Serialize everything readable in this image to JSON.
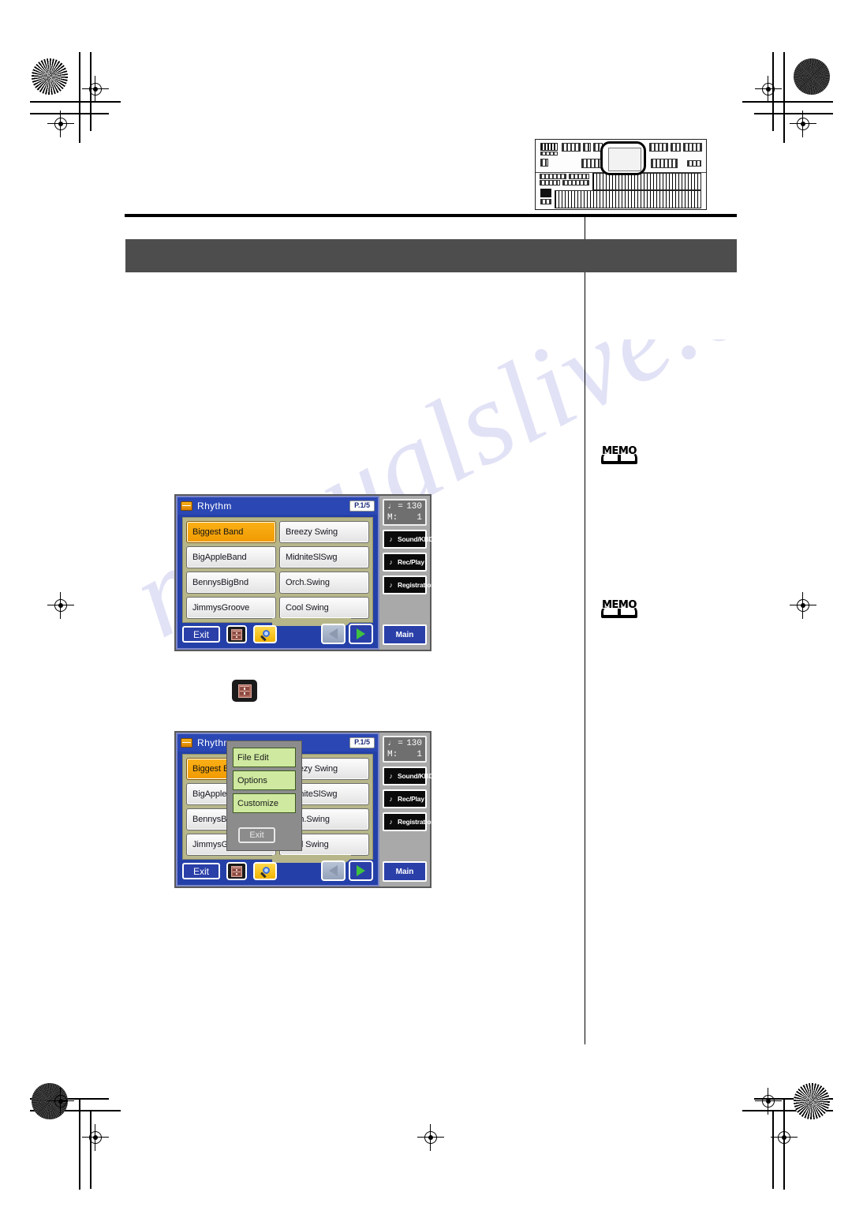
{
  "page": {
    "background_color": "#ffffff",
    "band_color": "#4d4d4d",
    "watermark_text": "manualslive.com"
  },
  "illustration": {
    "name": "electronic-organ-front-panel",
    "highlight": "lcd-touch-screen"
  },
  "memos": [
    {
      "label": "MEMO"
    },
    {
      "label": "MEMO"
    }
  ],
  "callout": {
    "icon_label": "menu-icon"
  },
  "screen1": {
    "title": "Rhythm",
    "page_indicator": "P.1/5",
    "rhythms": [
      "Biggest Band",
      "Breezy Swing",
      "BigAppleBand",
      "MidniteSlSwg",
      "BennysBigBnd",
      "Orch.Swing",
      "JimmysGroove",
      "Cool Swing"
    ],
    "selected_index": 0,
    "toolbar": {
      "exit_label": "Exit",
      "menu_icon": "menu-icon",
      "search_icon": "search-icon",
      "prev_icon": "triangle-left-icon",
      "next_icon": "triangle-right-icon"
    },
    "rail": {
      "tempo_note": "♩ =",
      "tempo_value": "130",
      "measure_label": "M:",
      "measure_value": "1",
      "buttons": [
        {
          "label": "Sound/KBD",
          "icon": "note-icon"
        },
        {
          "label": "Rec/Play",
          "icon": "speaker-icon"
        },
        {
          "label": "Registration",
          "icon": "organ-icon"
        }
      ],
      "main_label": "Main"
    }
  },
  "screen2": {
    "title": "Rhythm",
    "page_indicator": "P.1/5",
    "rhythms": [
      "Biggest Band",
      "Breezy Swing",
      "BigAppleBand",
      "MidniteSlSwg",
      "BennysBigBnd",
      "Orch.Swing",
      "JimmysGroove",
      "Cool Swing"
    ],
    "selected_index": 0,
    "popup": {
      "items": [
        "File Edit",
        "Options",
        "Customize"
      ],
      "exit_label": "Exit"
    },
    "toolbar": {
      "exit_label": "Exit",
      "menu_icon": "menu-icon",
      "search_icon": "search-icon",
      "prev_icon": "triangle-left-icon",
      "next_icon": "triangle-right-icon"
    },
    "rail": {
      "tempo_note": "♩ =",
      "tempo_value": "130",
      "measure_label": "M:",
      "measure_value": "1",
      "buttons": [
        {
          "label": "Sound/KBD",
          "icon": "note-icon"
        },
        {
          "label": "Rec/Play",
          "icon": "speaker-icon"
        },
        {
          "label": "Registration",
          "icon": "organ-icon"
        }
      ],
      "main_label": "Main"
    }
  }
}
